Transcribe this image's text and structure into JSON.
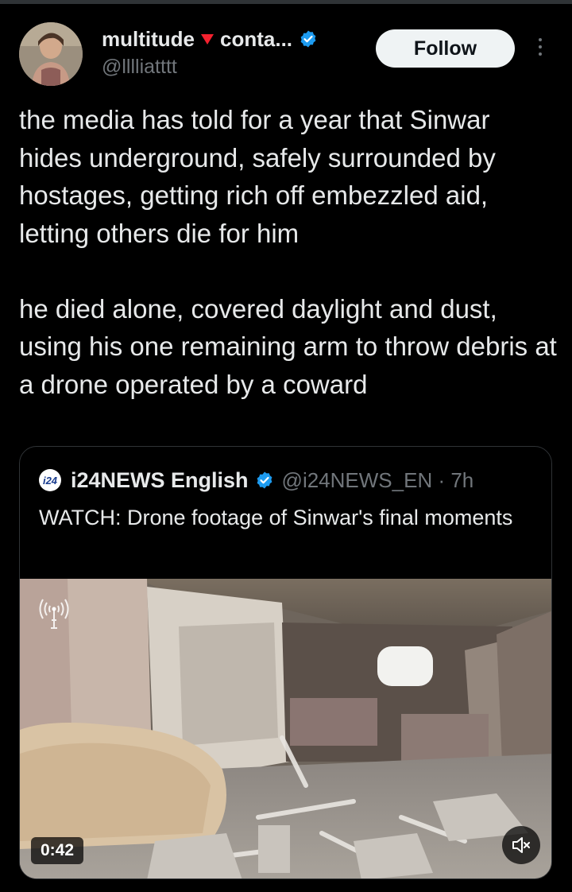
{
  "tweet": {
    "author": {
      "display_name": "multitude",
      "name_suffix": "conta...",
      "flag_color": "#f4212e",
      "handle": "@lllliatttt",
      "verified": true
    },
    "follow_label": "Follow",
    "more_icon": "more-vertical-icon",
    "text": "the media has told for a year that Sinwar hides underground, safely surrounded by hostages, getting rich off embezzled aid, letting others die for him\n\nhe died alone, covered daylight and dust, using his one remaining arm to throw debris at a drone operated by a coward"
  },
  "quote": {
    "logo_text": "i24",
    "display_name": "i24NEWS English",
    "verified": true,
    "handle_time": "@i24NEWS_EN · 7h",
    "text": "WATCH: Drone footage of Sinwar's final moments",
    "video": {
      "duration": "0:42",
      "mute_icon": "volume-muted-icon",
      "overlay_icon": "broadcast-tower-icon"
    }
  },
  "colors": {
    "background": "#000000",
    "text": "#e7e9ea",
    "secondary": "#71767b",
    "border": "#2f3336",
    "verified": "#1d9bf0",
    "follow_bg": "#eff3f4"
  }
}
